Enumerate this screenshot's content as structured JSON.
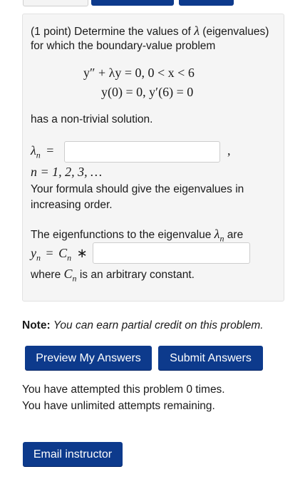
{
  "problem": {
    "intro": "(1 point) Determine the values of λ (eigenvalues) for which the boundary-value problem",
    "intro_line1": "(1 point) Determine the values of",
    "intro_lambda": "λ",
    "intro_line1_end": "(eigenvalues)",
    "intro_line2": "for which the boundary-value problem",
    "eq1": "y″ + λy = 0,   0 < x < 6",
    "eq2": "y(0) = 0,  y′(6) = 0",
    "nontrivial": "has a non-trivial solution.",
    "lambda_label": "λ",
    "lambda_sub": "n",
    "equals": "=",
    "comma": ",",
    "lambda_answer": {
      "value": "",
      "placeholder": ""
    },
    "n_range": "n = 1, 2, 3, …",
    "order_line1": "Your formula should give the eigenvalues in",
    "order_line2": "increasing order.",
    "eigenfunc_text": "The eigenfunctions to the eigenvalue",
    "eigenfunc_are": "are",
    "yn_label": "y",
    "yn_sub": "n",
    "cn_label": "C",
    "cn_sub": "n",
    "star": "∗",
    "eigenfunc_answer": {
      "value": "",
      "placeholder": ""
    },
    "where_text": "where",
    "arbitrary_text": "is an arbitrary constant."
  },
  "note": {
    "label": "Note:",
    "text": "You can earn partial credit on this problem."
  },
  "buttons": {
    "preview": "Preview My Answers",
    "submit": "Submit Answers",
    "email": "Email instructor"
  },
  "attempts": {
    "line1": "You have attempted this problem 0 times.",
    "line2": "You have unlimited attempts remaining."
  },
  "colors": {
    "button_bg": "#0d3a8c",
    "panel_bg": "#f5f5f5"
  }
}
